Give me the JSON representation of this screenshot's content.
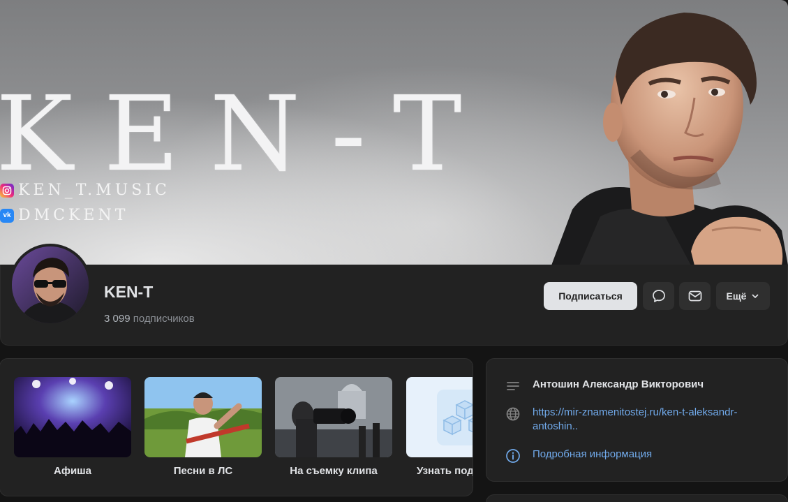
{
  "cover": {
    "title": "KEN-T",
    "instagram_handle": "KEN_T.MUSIC",
    "vk_handle": "DMCKENT",
    "vk_badge": "vk"
  },
  "profile": {
    "name": "KEN-T",
    "subscribers_count": "3 099",
    "subscribers_label": "подписчиков"
  },
  "actions": {
    "subscribe_label": "Подписаться",
    "more_label": "Ещё",
    "message_icon": "chat-bubble-icon",
    "mail_icon": "envelope-icon"
  },
  "links": [
    {
      "label": "Афиша"
    },
    {
      "label": "Песни в ЛС"
    },
    {
      "label": "На съемку клипа"
    },
    {
      "label": "Узнать под"
    }
  ],
  "info": {
    "full_name": "Антошин Александр Викторович",
    "website": "https://mir-znamenitostej.ru/ken-t-aleksandr-antoshin..",
    "more_label": "Подробная информация"
  },
  "colors": {
    "background": "#141414",
    "card": "#222222",
    "accent_link": "#71aaeb",
    "subscribe_button": "#e1e3e6"
  }
}
